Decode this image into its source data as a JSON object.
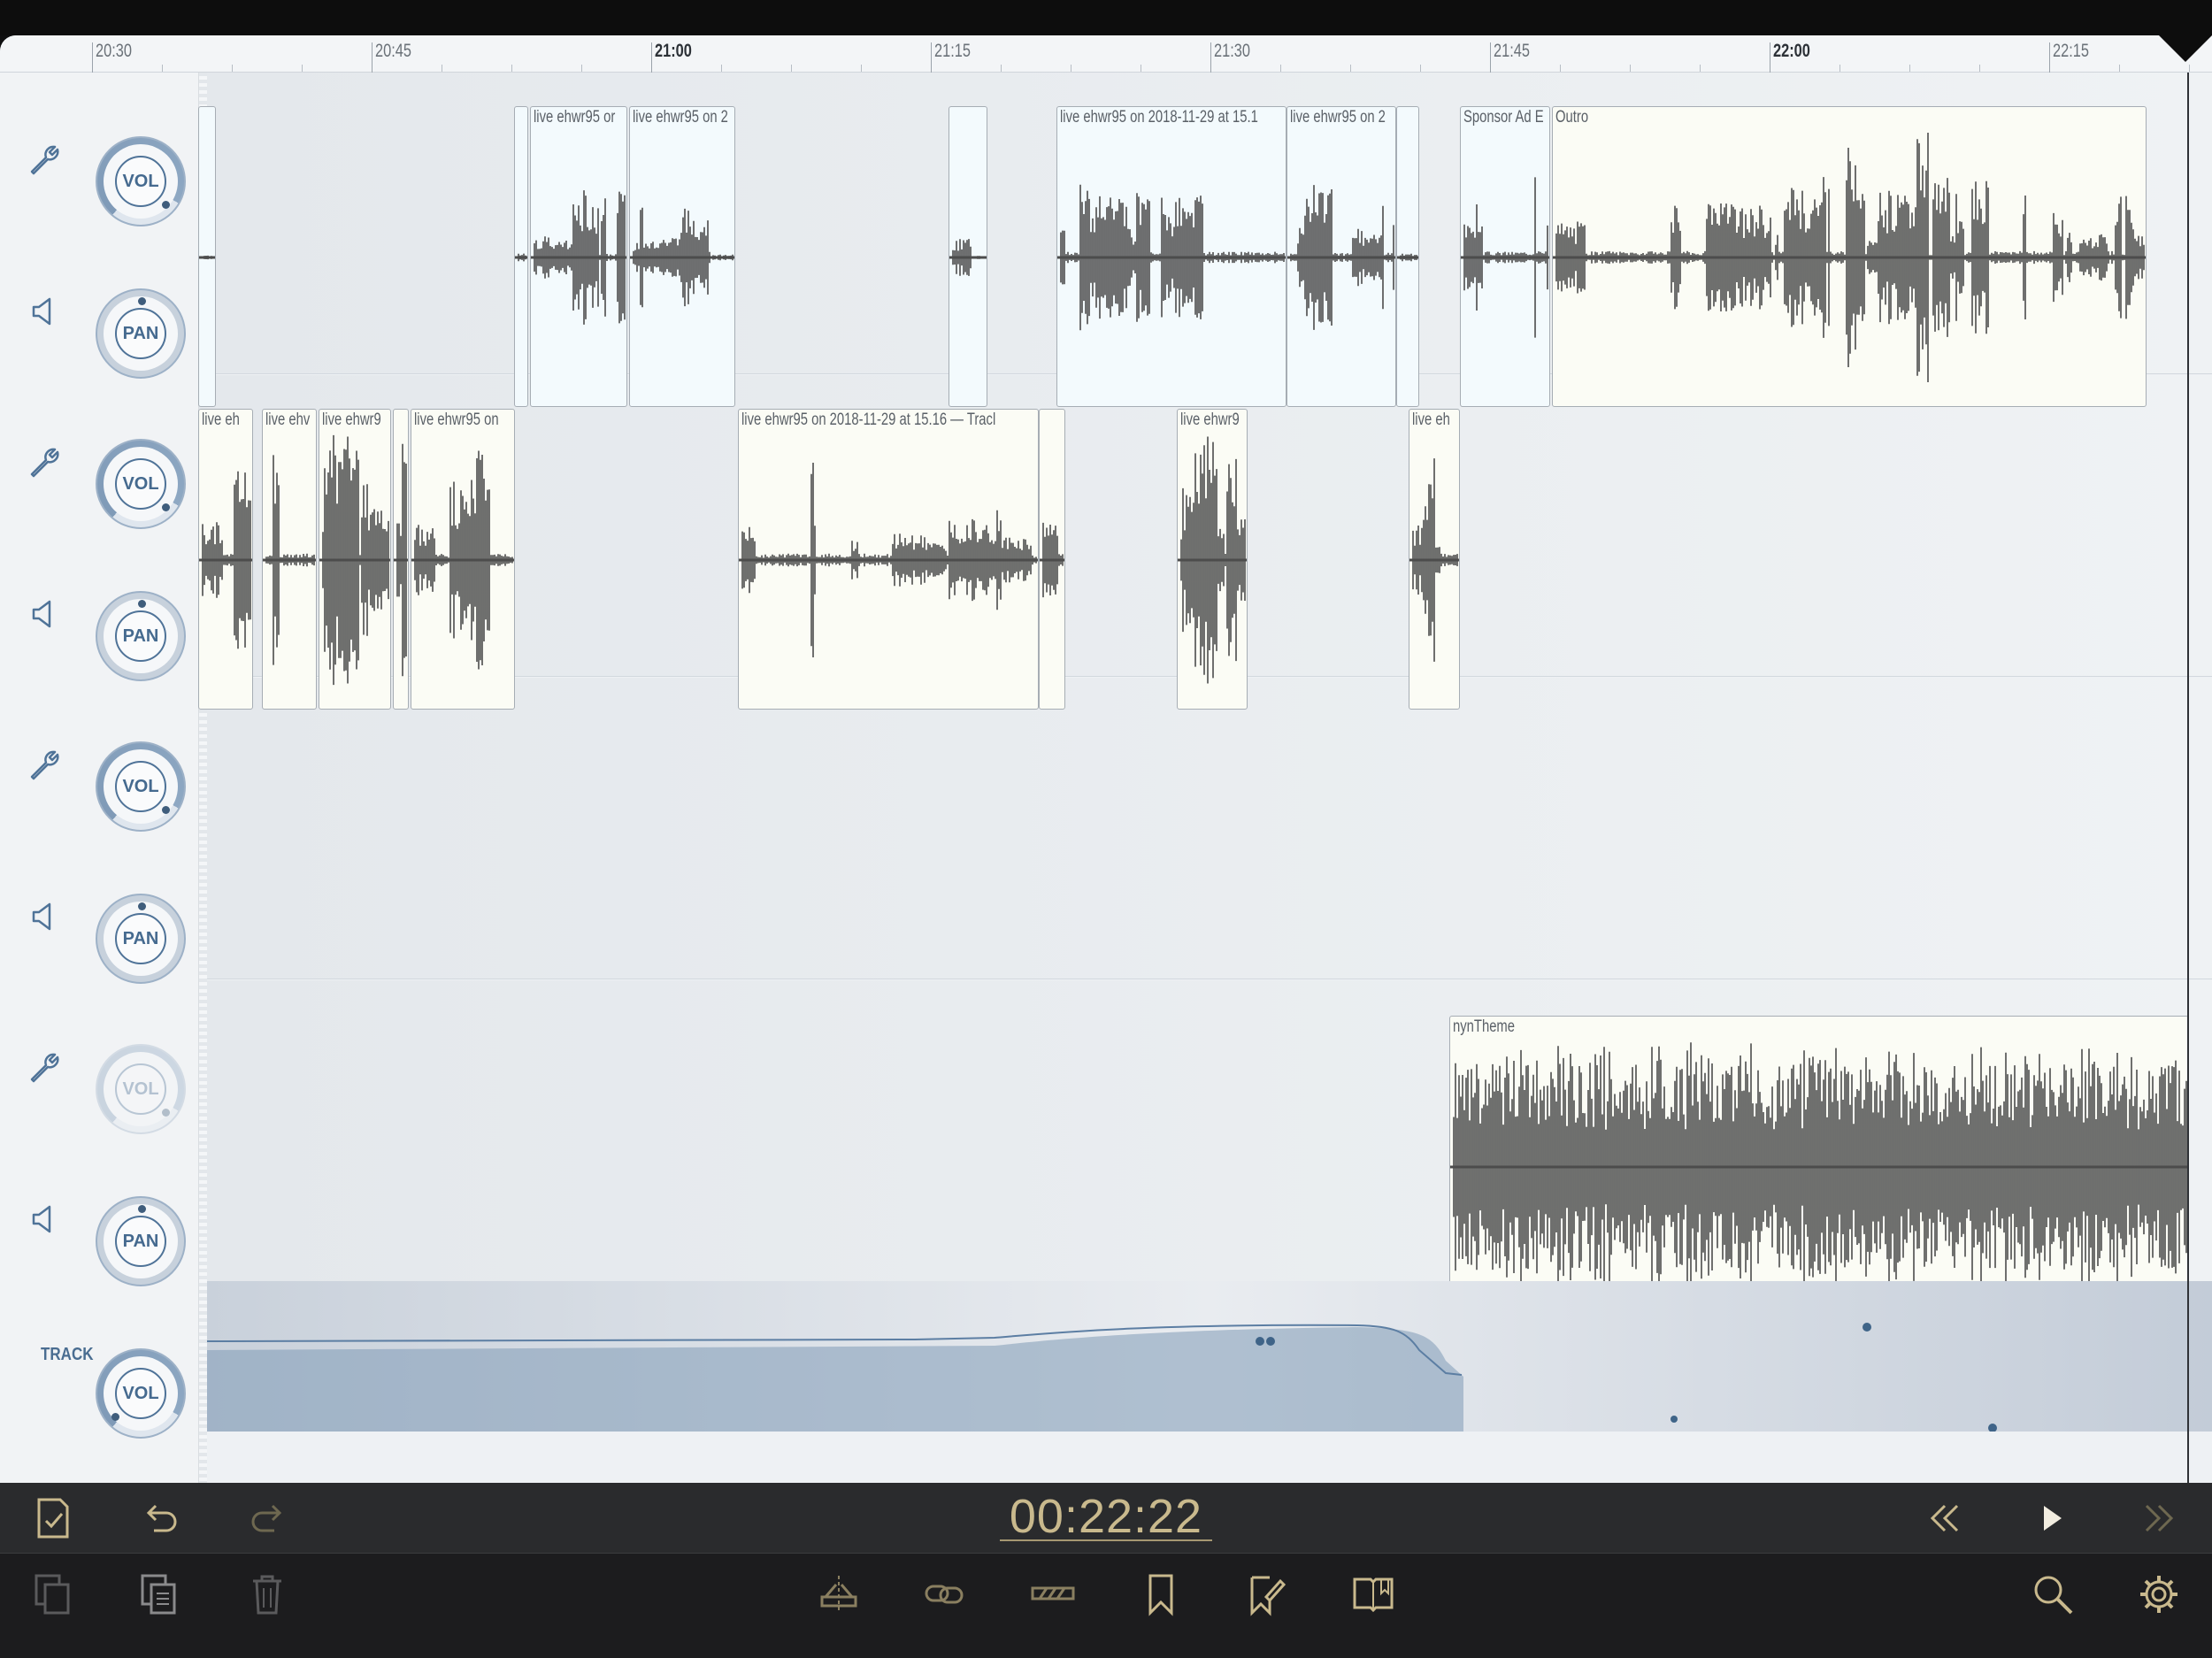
{
  "ruler": {
    "labels": [
      {
        "text": "20:30",
        "major": false
      },
      {
        "text": "20:45",
        "major": false
      },
      {
        "text": "21:00",
        "major": true
      },
      {
        "text": "21:15",
        "major": false
      },
      {
        "text": "21:30",
        "major": false
      },
      {
        "text": "21:45",
        "major": false
      },
      {
        "text": "22:00",
        "major": true
      },
      {
        "text": "22:15",
        "major": false
      }
    ]
  },
  "lanes": [
    {
      "vol_label": "VOL",
      "pan_label": "PAN",
      "enabled": true
    },
    {
      "vol_label": "VOL",
      "pan_label": "PAN",
      "enabled": true
    },
    {
      "vol_label": "VOL",
      "pan_label": "PAN",
      "enabled": true
    },
    {
      "vol_label": "VOL",
      "pan_label": "PAN",
      "enabled": false
    }
  ],
  "master": {
    "track_label": "TRACK",
    "vol_label": "VOL"
  },
  "clips": {
    "track1": [
      "",
      "live ehwr95 or",
      "live ehwr95 on 2",
      "",
      "live ehwr95 on 2018-11-29 at 15.1",
      "live ehwr95 on 2",
      "",
      "Sponsor Ad E",
      "Outro"
    ],
    "track2": [
      "live eh",
      "live ehv",
      "live ehwr9",
      "",
      "live ehwr95 on",
      "live ehwr95 on 2018-11-29 at 15.16 — Tracl",
      "",
      "live ehwr9",
      "live eh"
    ],
    "track4": [
      "nynTheme"
    ]
  },
  "transport": {
    "time": "00:22:22"
  },
  "icons": {
    "settings": "wrench-icon",
    "speaker": "speaker-icon",
    "document": "document-check-icon",
    "undo": "undo-icon",
    "redo": "redo-icon",
    "rewind": "rewind-icon",
    "play": "play-icon",
    "forward": "fast-forward-icon",
    "copy": "copy-icon",
    "paste": "paste-icon",
    "trash": "trash-icon",
    "split": "split-icon",
    "link": "link-icon",
    "fade": "fade-icon",
    "bookmark": "bookmark-icon",
    "edit_marker": "edit-marker-icon",
    "chapters": "chapters-icon",
    "search": "search-icon",
    "gear": "gear-icon"
  },
  "colors": {
    "accent_gold": "#c9b98d",
    "knob_blue": "#456a8f",
    "waveform": "#4c4c4c"
  }
}
